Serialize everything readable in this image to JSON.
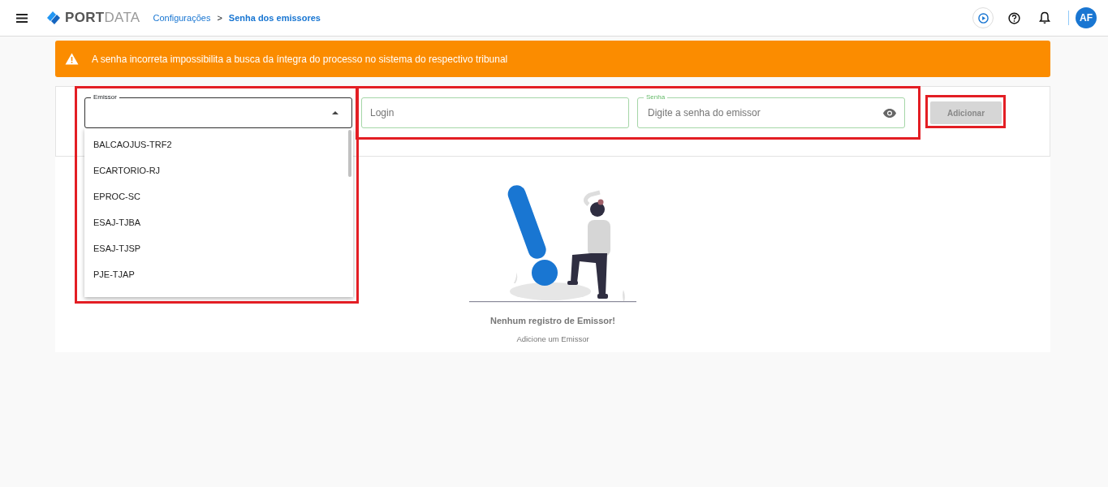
{
  "header": {
    "logo": {
      "bold": "PORT",
      "light": "DATA"
    },
    "breadcrumb": [
      {
        "label": "Configurações",
        "current": false
      },
      {
        "label": "Senha dos emissores",
        "current": true
      }
    ],
    "separator": ">",
    "avatar": "AF"
  },
  "alert": {
    "message": "A senha incorreta impossibilita a busca da íntegra do processo no sistema do respectivo tribunal"
  },
  "form": {
    "emissor": {
      "label": "Emissor",
      "expanded": true,
      "options": [
        "BALCAOJUS-TRF2",
        "ECARTORIO-RJ",
        "EPROC-SC",
        "ESAJ-TJBA",
        "ESAJ-TJSP",
        "PJE-TJAP"
      ]
    },
    "login": {
      "placeholder": "Login"
    },
    "senha": {
      "label": "Senha",
      "placeholder": "Digite a senha do emissor"
    },
    "add_button": {
      "label": "Adicionar",
      "disabled": true
    }
  },
  "empty_state": {
    "title": "Nenhum registro de Emissor!",
    "subtitle": "Adicione um Emissor"
  }
}
